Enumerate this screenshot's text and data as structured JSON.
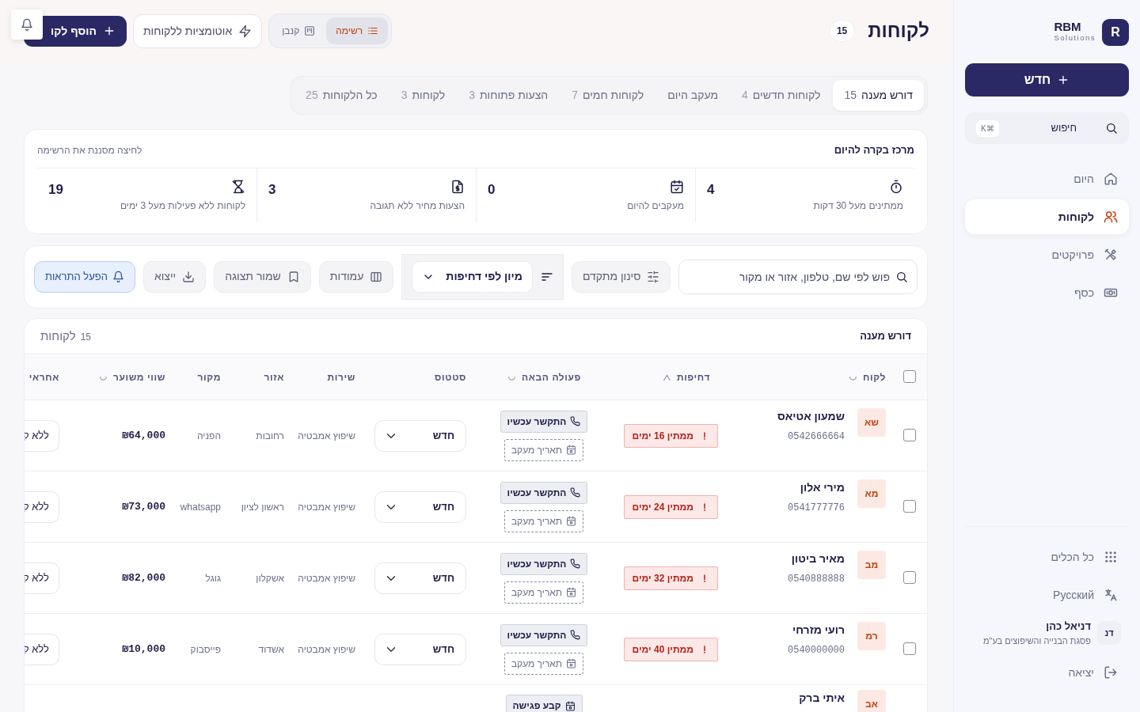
{
  "sidebar": {
    "logo": {
      "letter": "R",
      "name": "RBM",
      "tagline": "Solutions"
    },
    "new_button": "חדש",
    "search": {
      "label": "חיפוש",
      "shortcut": "K⌘"
    },
    "nav": [
      {
        "label": "היום",
        "kind": "home",
        "selected": false
      },
      {
        "label": "לקוחות",
        "kind": "users",
        "selected": true
      },
      {
        "label": "פרויקטים",
        "kind": "tools",
        "selected": false
      },
      {
        "label": "כסף",
        "kind": "money",
        "selected": false
      }
    ],
    "footer": [
      {
        "label": "כל הכלים",
        "kind": "grid"
      },
      {
        "label": "Русский",
        "kind": "translate"
      }
    ],
    "user": {
      "initials": "דנ",
      "name": "דניאל כהן",
      "company": "פסגת הבנייה והשיפוצים בע\"מ"
    },
    "logout": "יציאה"
  },
  "header": {
    "title": "לקוחות",
    "count": "15",
    "views": [
      {
        "label": "רשימה",
        "kind": "list",
        "selected": true
      },
      {
        "label": "קנבן",
        "kind": "kanban",
        "selected": false
      }
    ],
    "automations_button": "אוטומציות ללקוחות",
    "add_button": "הוסף לקו"
  },
  "tabs": [
    {
      "label": "דורש מענה",
      "count": "15",
      "selected": true
    },
    {
      "label": "לקוחות חדשים",
      "count": "4",
      "selected": false
    },
    {
      "label": "מעקב היום",
      "selected": false
    },
    {
      "label": "לקוחות חמים",
      "count": "7",
      "selected": false
    },
    {
      "label": "הצעות פתוחות",
      "count": "3",
      "selected": false
    },
    {
      "label": "לקוחות",
      "count": "3",
      "selected": false
    },
    {
      "label": "כל הלקוחות",
      "count": "25",
      "selected": false
    }
  ],
  "summary": {
    "title": "מרכז בקרה להיום",
    "hint": "לחיצה מסננת את הרשימה",
    "stats": [
      {
        "kind": "timer",
        "value": "4",
        "label": "ממתינים מעל 30 דקות"
      },
      {
        "kind": "calendar",
        "value": "0",
        "label": "מעקבים להיום"
      },
      {
        "kind": "quote",
        "value": "3",
        "label": "הצעות מחיר ללא תגובה"
      },
      {
        "kind": "inactive",
        "value": "19",
        "label": "לקוחות ללא פעילות מעל 3 ימים"
      }
    ]
  },
  "toolbar": {
    "search": {
      "placeholder": "פוש לפי שם, טלפון, אזור או מקור"
    },
    "filter_button": "סינון מתקדם",
    "sort_select": "מיון לפי דחיפות",
    "columns_button": "עמודות",
    "save_view_button": "שמור תצוגה",
    "export_button": "ייצוא",
    "alerts_button": "הפעל התראות"
  },
  "table": {
    "title": "דורש מענה",
    "count": "15",
    "count_label": "לקוחות",
    "select_all": false,
    "columns": [
      {
        "label": "לקוח",
        "sorted": false
      },
      {
        "label": "דחיפות",
        "sorted": true
      },
      {
        "label": "פעולה הבאה",
        "sorted": false
      },
      {
        "label": "סטטוס"
      },
      {
        "label": "שירות"
      },
      {
        "label": "אזור"
      },
      {
        "label": "מקור"
      },
      {
        "label": "שווי משוער",
        "sorted": false
      },
      {
        "label": "אחראי"
      }
    ],
    "rows": [
      {
        "selected": false,
        "initials": "שא",
        "name": "שמעון אטיאס",
        "phone": "0542666664",
        "urgency": "ממתין 16 ימים",
        "action": {
          "kind": "call",
          "label": "התקשר עכשיו"
        },
        "followup": "תאריך מעקב",
        "status": "חדש",
        "service": "שיפוץ אמבטיה",
        "area": "רחובות",
        "source": "הפניה",
        "value": "₪64,000",
        "owner": "ללא ק"
      },
      {
        "selected": false,
        "initials": "מא",
        "name": "מירי אלון",
        "phone": "0541777776",
        "urgency": "ממתין 24 ימים",
        "action": {
          "kind": "call",
          "label": "התקשר עכשיו"
        },
        "followup": "תאריך מעקב",
        "status": "חדש",
        "service": "שיפוץ אמבטיה",
        "area": "ראשון לציון",
        "source": "whatsapp",
        "value": "₪73,000",
        "owner": "ללא ק"
      },
      {
        "selected": false,
        "initials": "מב",
        "name": "מאיר ביטון",
        "phone": "0540888888",
        "urgency": "ממתין 32 ימים",
        "action": {
          "kind": "call",
          "label": "התקשר עכשיו"
        },
        "followup": "תאריך מעקב",
        "status": "חדש",
        "service": "שיפוץ אמבטיה",
        "area": "אשקלון",
        "source": "גוגל",
        "value": "₪82,000",
        "owner": "ללא ק"
      },
      {
        "selected": false,
        "initials": "רמ",
        "name": "רועי מזרחי",
        "phone": "0540000000",
        "urgency": "ממתין 40 ימים",
        "action": {
          "kind": "call",
          "label": "התקשר עכשיו"
        },
        "followup": "תאריך מעקב",
        "status": "חדש",
        "service": "שיפוץ אמבטיה",
        "area": "אשדוד",
        "source": "פייסבוק",
        "value": "₪10,000",
        "owner": "ללא ק"
      },
      {
        "initials": "אב",
        "name": "איתי ברק",
        "action": {
          "kind": "meeting",
          "label": "קבע פגישה"
        }
      }
    ]
  }
}
